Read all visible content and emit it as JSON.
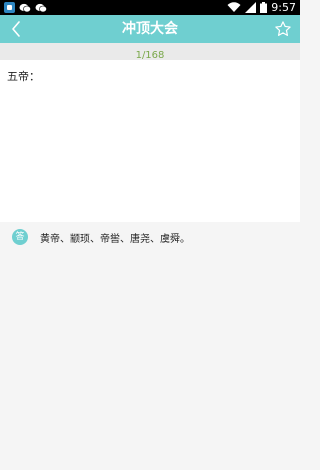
{
  "status_bar": {
    "time": "9:57",
    "icons": [
      "app-icon",
      "wechat-icon",
      "wechat-icon",
      "wifi-icon",
      "signal-icon",
      "battery-icon"
    ]
  },
  "header": {
    "title": "冲顶大会",
    "back_icon": "chevron-left-icon",
    "favorite_icon": "star-outline-icon",
    "background_color": "#6fcfd0"
  },
  "progress": {
    "text": "1/168",
    "color": "#7aa84a"
  },
  "question": {
    "text": "五帝："
  },
  "answer": {
    "badge": "答",
    "text": "黄帝、颛顼、帝喾、唐尧、虞舜。"
  }
}
